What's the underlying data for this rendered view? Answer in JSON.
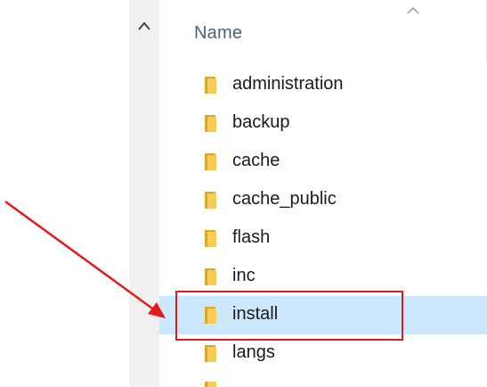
{
  "file_list": {
    "column_header": "Name",
    "items": [
      {
        "label": "administration",
        "selected": false
      },
      {
        "label": "backup",
        "selected": false
      },
      {
        "label": "cache",
        "selected": false
      },
      {
        "label": "cache_public",
        "selected": false
      },
      {
        "label": "flash",
        "selected": false
      },
      {
        "label": "inc",
        "selected": false
      },
      {
        "label": "install",
        "selected": true
      },
      {
        "label": "langs",
        "selected": false
      }
    ]
  },
  "icons": {
    "scroll_up": "chevron-up-icon",
    "sort": "sort-caret-icon",
    "folder": "folder-icon",
    "annotation_arrow": "arrow-icon"
  },
  "colors": {
    "selection": "#cce8ff",
    "annotation": "#e11b1b",
    "folder": "#f0c649",
    "header_text": "#4c607a"
  }
}
